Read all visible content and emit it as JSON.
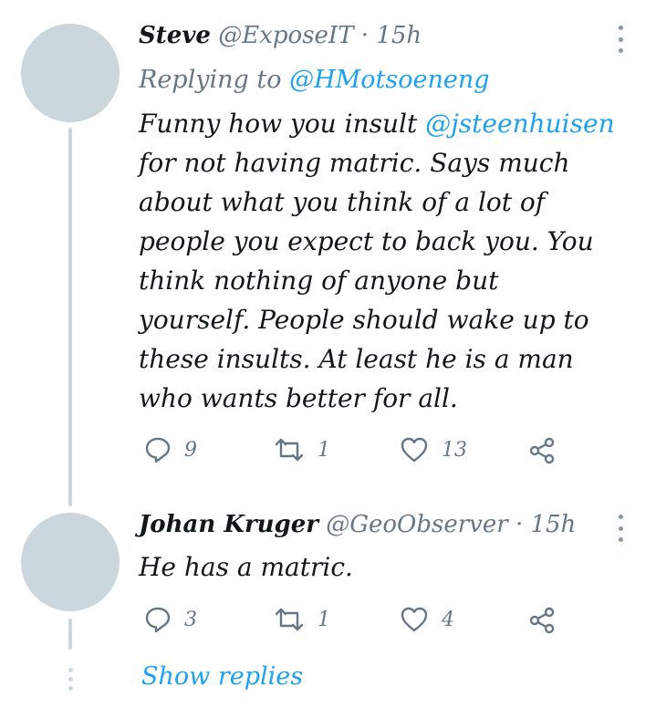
{
  "tweets": [
    {
      "name": "Steve",
      "handle": "@ExposeIT",
      "dot": "·",
      "time": "15h",
      "replying_prefix": "Replying to ",
      "replying_handle": "@HMotsoeneng",
      "mention": "@jsteenhuisen",
      "text_lines": [
        "for not having matric. Says much",
        "about what you think of a lot of",
        "people you expect to back you. You",
        "think nothing of anyone but",
        "yourself. People should wake up to",
        "these insults. At least he is a man",
        "who wants better for all."
      ],
      "text_start": "Funny how you insult ",
      "replies": "9",
      "retweets": "1",
      "likes": "13"
    },
    {
      "name": "Johan Kruger",
      "handle": "@GeoObserver",
      "dot": "·",
      "time": "15h",
      "text": "He has a matric.",
      "replies": "3",
      "retweets": "1",
      "likes": "4"
    }
  ],
  "show_replies": "Show replies",
  "icons": [
    "more-vertical-icon",
    "reply-icon",
    "retweet-icon",
    "like-icon",
    "share-icon"
  ],
  "colors": {
    "link": "#1da1f2",
    "muted": "#657786",
    "avatar": "#ccd6dd"
  }
}
